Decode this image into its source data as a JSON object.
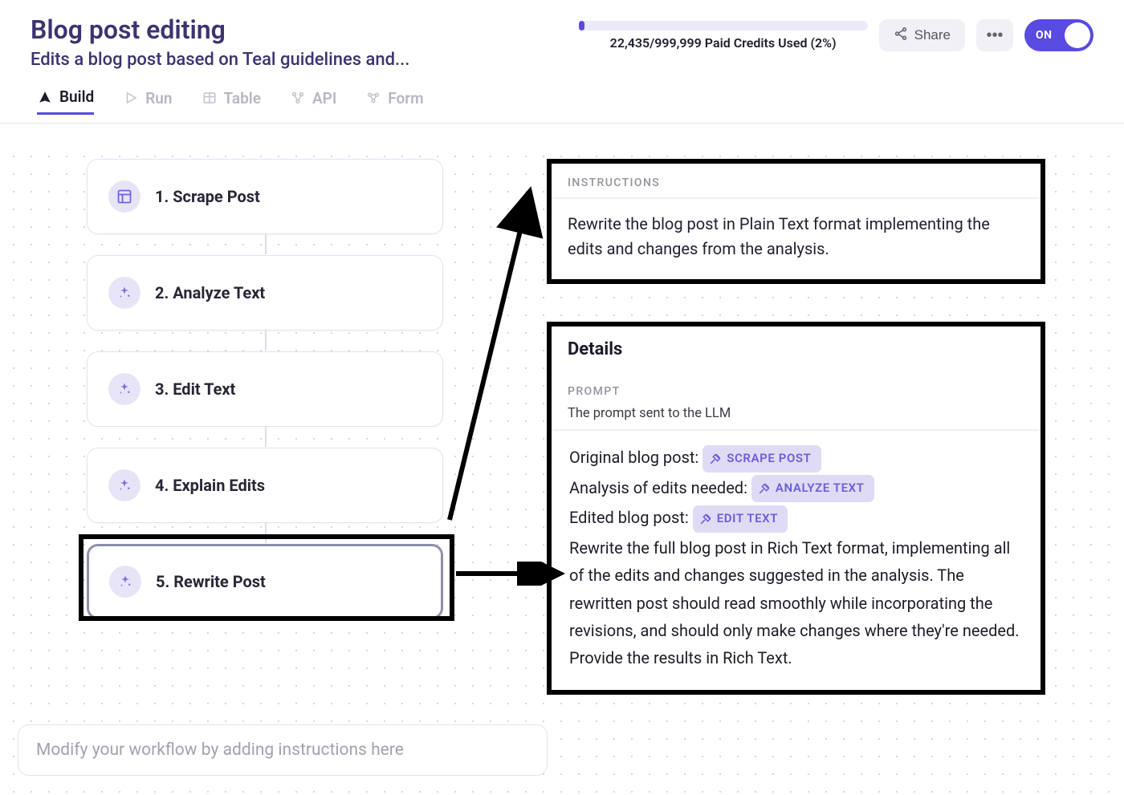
{
  "header": {
    "title": "Blog post editing",
    "subtitle": "Edits a blog post based on Teal guidelines and...",
    "credits_text": "22,435/999,999 Paid Credits Used (2%)",
    "credits_percent": 2,
    "share_label": "Share",
    "toggle_label": "ON"
  },
  "tabs": [
    {
      "label": "Build",
      "active": true
    },
    {
      "label": "Run",
      "active": false
    },
    {
      "label": "Table",
      "active": false
    },
    {
      "label": "API",
      "active": false
    },
    {
      "label": "Form",
      "active": false
    }
  ],
  "nodes": [
    {
      "label": "1. Scrape Post",
      "icon": "layout",
      "selected": false
    },
    {
      "label": "2. Analyze Text",
      "icon": "sparkle",
      "selected": false
    },
    {
      "label": "3. Edit Text",
      "icon": "sparkle",
      "selected": false
    },
    {
      "label": "4. Explain Edits",
      "icon": "sparkle",
      "selected": false
    },
    {
      "label": "5. Rewrite Post",
      "icon": "sparkle",
      "selected": true
    }
  ],
  "instructions": {
    "section_label": "INSTRUCTIONS",
    "body": "Rewrite the blog post in Plain Text format implementing the edits and changes from the analysis."
  },
  "details": {
    "heading": "Details",
    "prompt_label": "PROMPT",
    "prompt_desc": "The prompt sent to the LLM",
    "lines": {
      "l1_prefix": "Original blog post: ",
      "l1_badge": "SCRAPE POST",
      "l2_prefix": "Analysis of edits needed: ",
      "l2_badge": "ANALYZE TEXT",
      "l3_prefix": "Edited blog post: ",
      "l3_badge": "EDIT TEXT",
      "body": "Rewrite the full blog post in Rich Text format, implementing all of the edits and changes suggested in the analysis. The rewritten post should read smoothly while incorporating the revisions, and should only make changes where they're needed.",
      "tail": "Provide the results in Rich Text."
    }
  },
  "modify_placeholder": "Modify your workflow by adding instructions here"
}
